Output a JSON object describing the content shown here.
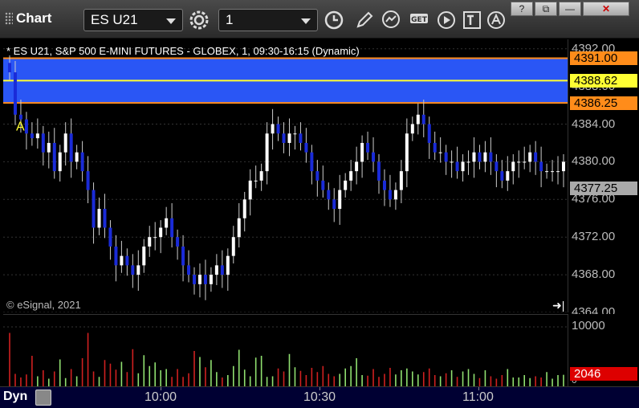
{
  "toolbar": {
    "title": "Chart",
    "symbol": "ES U21",
    "interval": "1",
    "icons": [
      "gear-icon",
      "clock-icon",
      "pencil-icon",
      "study-icon",
      "get-icon",
      "play-icon",
      "text-icon",
      "alert-icon"
    ],
    "window_buttons": [
      "?",
      "⧉",
      "—",
      "✕"
    ]
  },
  "chart": {
    "description": "* ES U21, S&P 500 E-MINI FUTURES - GLOBEX, 1, 09:30-16:15 (Dynamic)",
    "copyright": "© eSignal, 2021",
    "marker": "A",
    "colors": {
      "up": "#ffffff",
      "down": "#1a2bd8",
      "band": "#2a56f5",
      "band_edge": "#ff8c1a",
      "current_line": "#ffff33",
      "vol_up": "#90e070",
      "vol_down": "#d02020"
    }
  },
  "price_axis": {
    "ticks": [
      "4392.00",
      "4388.00",
      "4384.00",
      "4380.00",
      "4376.00",
      "4372.00",
      "4368.00",
      "4364.00"
    ],
    "band_high": "4391.00",
    "current": "4388.62",
    "band_low": "4386.25",
    "last": "4377.25"
  },
  "volume_axis": {
    "ticks": [
      "10000",
      "0"
    ],
    "last": "2046"
  },
  "time_axis": {
    "mode": "Dyn",
    "labels": [
      "10:00",
      "10:30",
      "11:00"
    ]
  },
  "chart_data": {
    "type": "candlestick",
    "y_range": [
      4364,
      4393
    ],
    "volume_range": [
      0,
      12000
    ],
    "band": [
      4386.25,
      4391.0
    ],
    "current_line": 4388.62,
    "last_price": 4377.25,
    "closes": [
      4389.5,
      4385,
      4384.5,
      4383,
      4382.5,
      4383,
      4381,
      4382,
      4379,
      4381,
      4383,
      4380,
      4381,
      4379,
      4377,
      4373,
      4375,
      4373,
      4371,
      4369,
      4370,
      4369,
      4368,
      4369,
      4371,
      4372,
      4372,
      4373,
      4374,
      4372,
      4371,
      4369,
      4368,
      4367,
      4368,
      4367,
      4368,
      4369,
      4368,
      4370,
      4372,
      4374,
      4376,
      4378,
      4378,
      4379,
      4383,
      4384,
      4383,
      4382,
      4383,
      4383,
      4382,
      4381,
      4379,
      4378,
      4377,
      4376,
      4375,
      4377,
      4378,
      4379,
      4380,
      4382,
      4381,
      4380,
      4378,
      4377,
      4376,
      4377,
      4379,
      4383,
      4384,
      4385,
      4384,
      4382,
      4381,
      4381,
      4380,
      4380,
      4379,
      4380,
      4380,
      4381,
      4380,
      4381,
      4380,
      4379,
      4378,
      4379,
      4380,
      4380,
      4380,
      4381,
      4380,
      4379,
      4379,
      4379,
      4379,
      4380
    ],
    "volume": [
      9000,
      2200,
      1600,
      2100,
      5200,
      1800,
      2800,
      1400,
      2600,
      4600,
      1500,
      3000,
      1800,
      4800,
      9000,
      2600,
      1700,
      4500,
      3900,
      2900,
      4200,
      2500,
      6300,
      2300,
      5300,
      3500,
      4100,
      2800,
      3000,
      1700,
      3000,
      1700,
      2300,
      6000,
      5000,
      3300,
      4500,
      2500,
      1600,
      2000,
      3500,
      6200,
      2900,
      1800,
      4900,
      5200,
      1700,
      1800,
      3100,
      2600,
      5500,
      3300,
      2700,
      2000,
      3200,
      2500,
      3500,
      2200,
      1800,
      2200,
      3100,
      3500,
      4800,
      2000,
      1900,
      3000,
      1700,
      2200,
      3200,
      2100,
      2800,
      3100,
      2600,
      2100,
      2500,
      3100,
      2000,
      1800,
      2300,
      2800,
      1700,
      2600,
      3000,
      2200,
      1500,
      2800,
      1800,
      1400,
      2000,
      3000,
      1600,
      1600,
      2000,
      1500,
      1800,
      1600,
      2500,
      1400,
      2000,
      2046
    ]
  }
}
